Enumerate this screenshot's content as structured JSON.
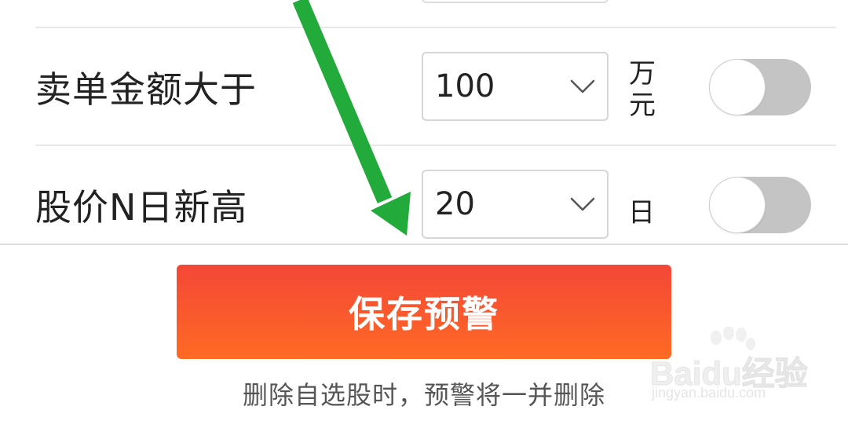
{
  "rows": [
    {
      "label": "卖单金额大于",
      "value": "100",
      "unit": "万元",
      "enabled": false
    },
    {
      "label": "股价N日新高",
      "value": "20",
      "unit": "日",
      "enabled": false
    }
  ],
  "save_button": {
    "label": "保存预警",
    "gradient_top": "#f34737",
    "gradient_bottom": "#ff6a24"
  },
  "hint": "删除自选股时，预警将一并删除",
  "annotation_arrow": {
    "color": "#22aa3a",
    "icon": "green-arrow-annotation"
  },
  "watermark": {
    "brand": "Baidu经验",
    "url": "jingyan.baidu.com"
  },
  "icons": {
    "select_arrow": "chevron-down-icon",
    "toggle": "toggle-switch"
  },
  "colors": {
    "toggle_off": "#c4c4c4",
    "divider": "#e8e8e8",
    "text": "#222222",
    "hint_text": "#555555"
  }
}
